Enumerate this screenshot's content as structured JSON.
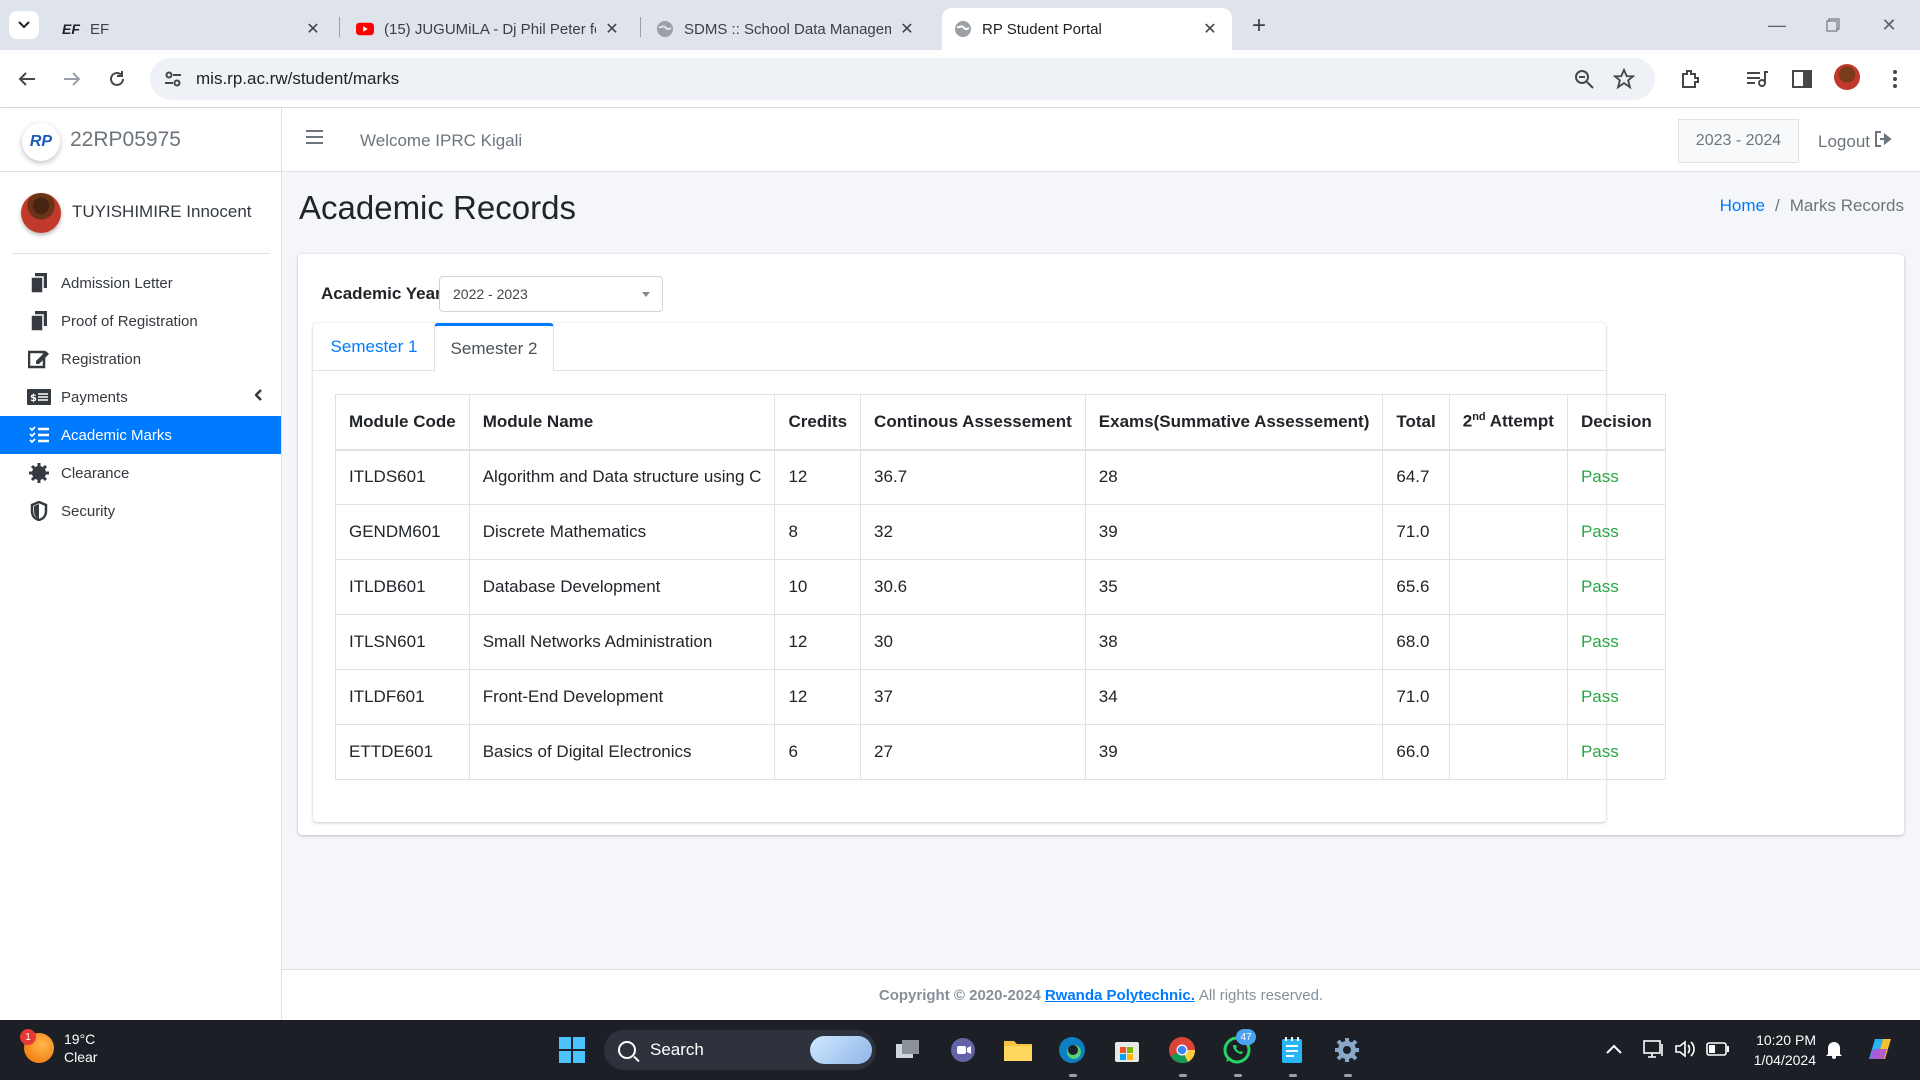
{
  "browser": {
    "tabs": [
      {
        "title": "EF",
        "favicon": "ef-logo-icon"
      },
      {
        "title": "(15) JUGUMiLA - Dj Phil Peter fe",
        "favicon": "youtube-icon"
      },
      {
        "title": "SDMS :: School Data Manageme",
        "favicon": "globe-icon"
      },
      {
        "title": "RP Student Portal",
        "favicon": "globe-icon"
      }
    ],
    "url": "mis.rp.ac.rw/student/marks"
  },
  "sidebar": {
    "brand": "22RP05975",
    "brand_logo_text": "RP",
    "user_name": "TUYISHIMIRE Innocent",
    "items": [
      {
        "label": "Admission Letter",
        "icon": "document-copy-icon"
      },
      {
        "label": "Proof of Registration",
        "icon": "document-copy-icon"
      },
      {
        "label": "Registration",
        "icon": "edit-icon"
      },
      {
        "label": "Payments",
        "icon": "money-bill-icon"
      },
      {
        "label": "Academic Marks",
        "icon": "list-icon"
      },
      {
        "label": "Clearance",
        "icon": "gear-icon"
      },
      {
        "label": "Security",
        "icon": "shield-icon"
      }
    ]
  },
  "header": {
    "welcome": "Welcome IPRC Kigali",
    "year_button": "2023 - 2024",
    "logout": "Logout"
  },
  "page": {
    "title": "Academic Records",
    "breadcrumb_home": "Home",
    "breadcrumb_current": "Marks Records",
    "academic_year_label": "Academic Year",
    "academic_year_value": "2022 - 2023",
    "semester_tabs": [
      "Semester 1",
      "Semester 2"
    ],
    "active_tab": "Semester 2"
  },
  "table": {
    "headers": [
      "Module Code",
      "Module Name",
      "Credits",
      "Continous Assessement",
      "Exams(Summative Assessement)",
      "Total",
      "2",
      "nd",
      " Attempt",
      "Decision"
    ],
    "rows": [
      [
        "ITLDS601",
        "Algorithm and Data structure using C",
        "12",
        "36.7",
        "28",
        "64.7",
        "",
        "Pass"
      ],
      [
        "GENDM601",
        "Discrete Mathematics",
        "8",
        "32",
        "39",
        "71.0",
        "",
        "Pass"
      ],
      [
        "ITLDB601",
        "Database Development",
        "10",
        "30.6",
        "35",
        "65.6",
        "",
        "Pass"
      ],
      [
        "ITLSN601",
        "Small Networks Administration",
        "12",
        "30",
        "38",
        "68.0",
        "",
        "Pass"
      ],
      [
        "ITLDF601",
        "Front-End Development",
        "12",
        "37",
        "34",
        "71.0",
        "",
        "Pass"
      ],
      [
        "ETTDE601",
        "Basics of Digital Electronics",
        "6",
        "27",
        "39",
        "66.0",
        "",
        "Pass"
      ]
    ]
  },
  "footer": {
    "copyright": "Copyright © 2020-2024",
    "org": "Rwanda Polytechnic.",
    "rights": "All rights reserved."
  },
  "taskbar": {
    "weather_temp": "19°C",
    "weather_desc": "Clear",
    "weather_badge": "1",
    "search": "Search",
    "whatsapp_badge": "47",
    "time": "10:20 PM",
    "date": "1/04/2024"
  },
  "colors": {
    "accent": "#007bff",
    "pass": "#28a745",
    "taskbar": "#1c1f26"
  }
}
